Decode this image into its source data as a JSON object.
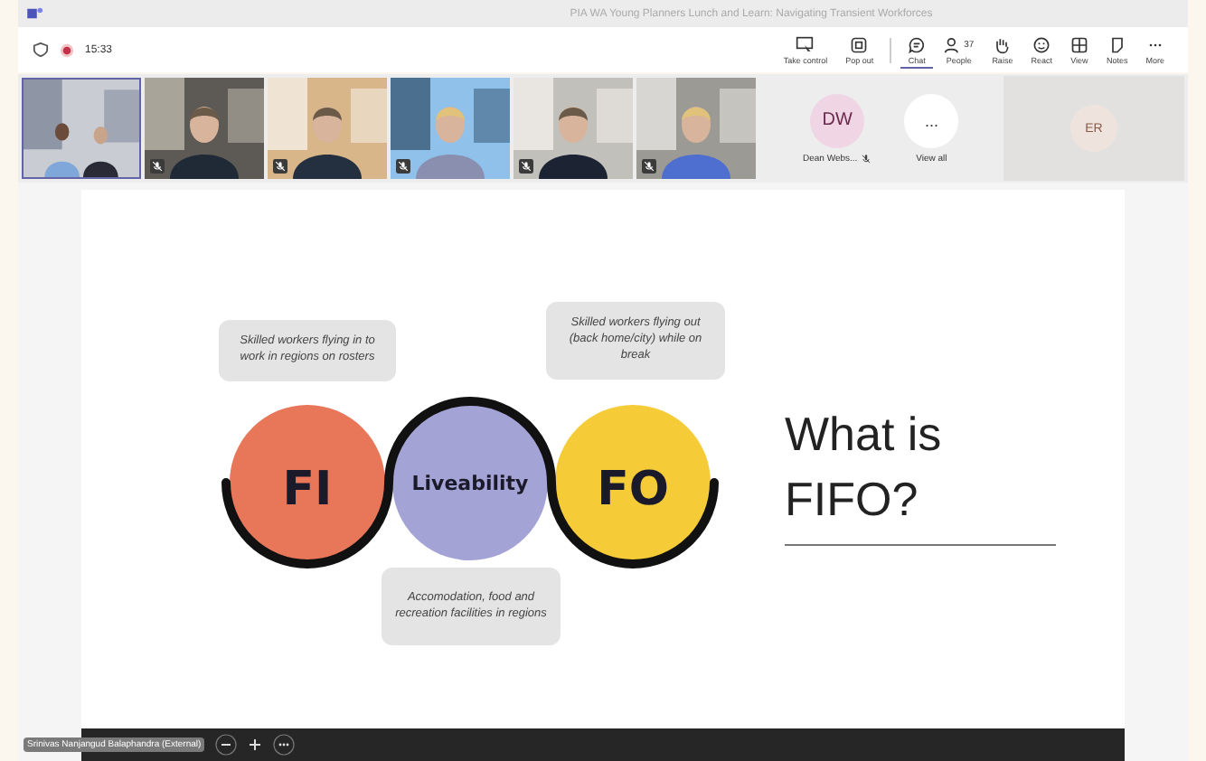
{
  "window": {
    "title": "PIA WA Young Planners Lunch and Learn: Navigating Transient Workforces"
  },
  "meeting": {
    "recording": true,
    "time": "15:33"
  },
  "toolbar": [
    {
      "kind": "take-control",
      "label": "Take control",
      "selected": false
    },
    {
      "kind": "pop-out",
      "label": "Pop out",
      "selected": false
    },
    {
      "kind": "chat",
      "label": "Chat",
      "selected": true
    },
    {
      "kind": "people",
      "label": "People",
      "count": "37",
      "selected": false
    },
    {
      "kind": "raise",
      "label": "Raise",
      "selected": false
    },
    {
      "kind": "react",
      "label": "React",
      "selected": false
    },
    {
      "kind": "view",
      "label": "View",
      "selected": false
    },
    {
      "kind": "notes",
      "label": "Notes",
      "selected": false
    },
    {
      "kind": "more",
      "label": "More",
      "selected": false
    }
  ],
  "videos": [
    {
      "kind": "picture",
      "selected": true,
      "muted": false
    },
    {
      "kind": "picture",
      "selected": false,
      "muted": true
    },
    {
      "kind": "picture",
      "selected": false,
      "muted": true
    },
    {
      "kind": "picture",
      "selected": false,
      "muted": true
    },
    {
      "kind": "picture",
      "selected": false,
      "muted": true
    },
    {
      "kind": "picture",
      "selected": false,
      "muted": true
    }
  ],
  "participants": [
    {
      "initials": "DW",
      "name": "Dean Webs...",
      "muted": true
    },
    {
      "initials": "...",
      "name": "View all"
    }
  ],
  "off_stage": {
    "initials": "ER"
  },
  "slide": {
    "title": "What is FIFO?",
    "circles": [
      {
        "label": "FI",
        "color": "#e8775a"
      },
      {
        "label": "Liveability",
        "color": "#a4a3d6"
      },
      {
        "label": "FO",
        "color": "#f5cc37"
      }
    ],
    "callouts": [
      "Skilled workers flying in to work in regions on rosters",
      "Skilled workers flying out (back home/city) while on break",
      "Accomodation, food and recreation facilities in regions"
    ]
  },
  "presenter": {
    "name": "Srinivas Nanjangud Balaphandra (External)"
  }
}
